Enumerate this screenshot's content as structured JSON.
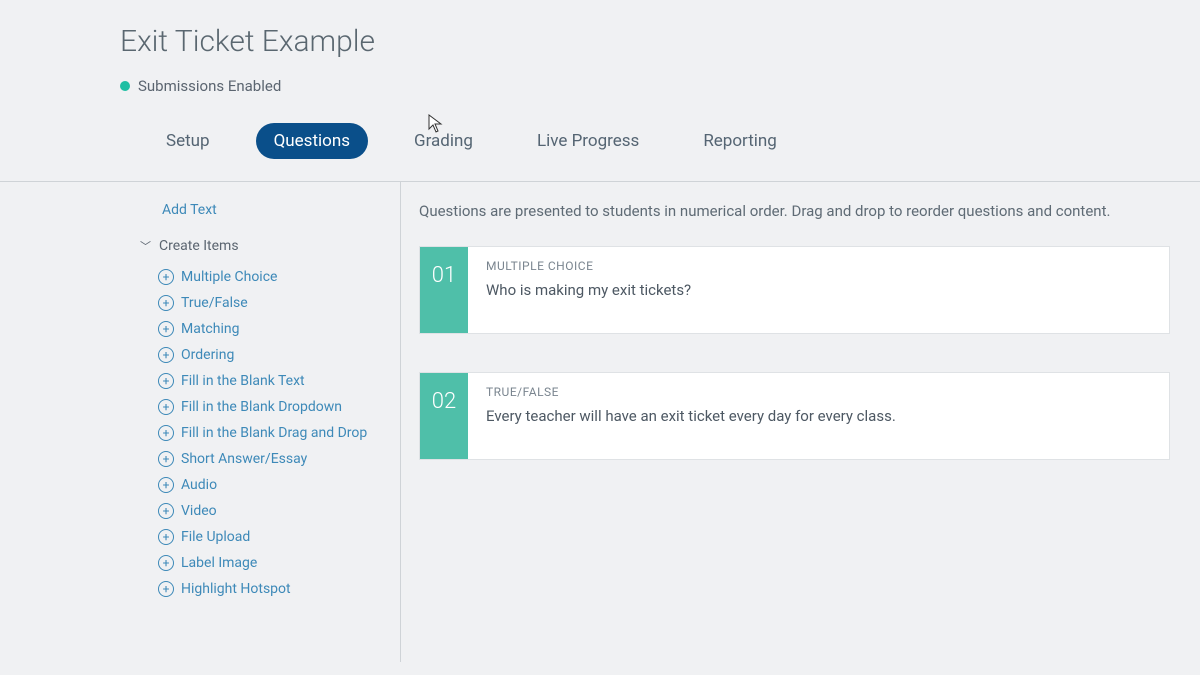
{
  "page": {
    "title": "Exit Ticket Example",
    "status": "Submissions Enabled"
  },
  "tabs": [
    {
      "label": "Setup",
      "active": false
    },
    {
      "label": "Questions",
      "active": true
    },
    {
      "label": "Grading",
      "active": false
    },
    {
      "label": "Live Progress",
      "active": false
    },
    {
      "label": "Reporting",
      "active": false
    }
  ],
  "sidebar": {
    "add_text": "Add Text",
    "create_items": "Create Items",
    "items": [
      "Multiple Choice",
      "True/False",
      "Matching",
      "Ordering",
      "Fill in the Blank Text",
      "Fill in the Blank Dropdown",
      "Fill in the Blank Drag and Drop",
      "Short Answer/Essay",
      "Audio",
      "Video",
      "File Upload",
      "Label Image",
      "Highlight Hotspot"
    ]
  },
  "main": {
    "instruction": "Questions are presented to students in numerical order. Drag and drop to reorder questions and content.",
    "questions": [
      {
        "num": "01",
        "type": "MULTIPLE CHOICE",
        "text": "Who is making my exit tickets?"
      },
      {
        "num": "02",
        "type": "TRUE/FALSE",
        "text": "Every teacher will have an exit ticket every day for every class."
      }
    ]
  }
}
